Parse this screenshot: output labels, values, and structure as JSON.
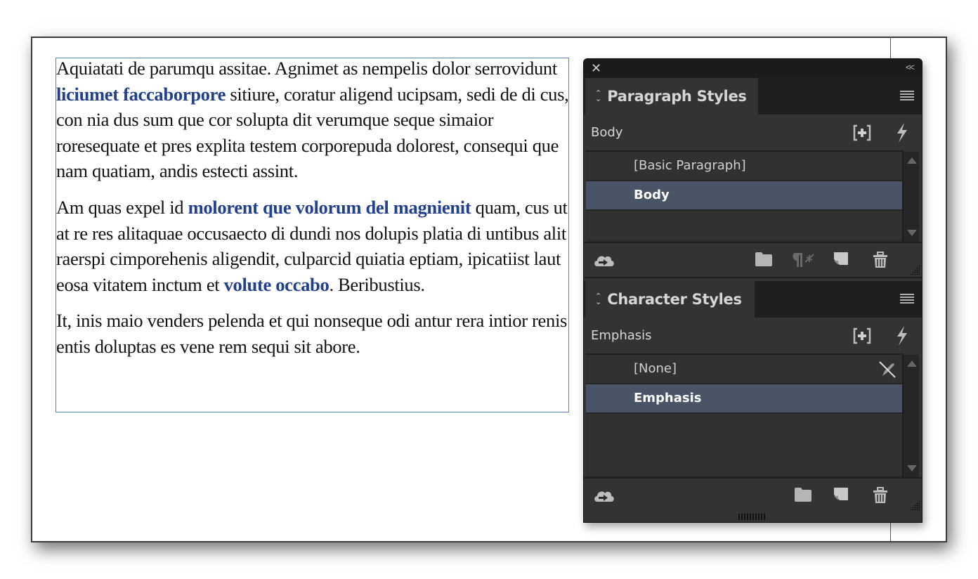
{
  "document": {
    "paragraphs": [
      {
        "runs": [
          {
            "text": "Aquiatati de parumqu assitae. Agnimet as nempelis dolor serrovidunt ",
            "style": "normal"
          },
          {
            "text": "liciumet faccaborpore",
            "style": "emphasis"
          },
          {
            "text": " sitiure, coratur aligend ucipsam, sedi de di cus, con nia dus sum que cor solupta dit verumque seque simaior roresequate et pres explita testem corporepuda dolorest, consequi que nam quatiam, andis estecti assint.",
            "style": "normal"
          }
        ]
      },
      {
        "runs": [
          {
            "text": "Am quas expel id ",
            "style": "normal"
          },
          {
            "text": "molorent que volorum del magnienit",
            "style": "emphasis"
          },
          {
            "text": " quam, cus ut at re res alitaquae occusaecto di dundi nos dolupis platia di untibus alit raerspi cimporehenis aligendit, culparcid quiatia eptiam, ipicatiist laut eosa vitatem inctum et ",
            "style": "normal"
          },
          {
            "text": "volute occabo",
            "style": "emphasis"
          },
          {
            "text": ". Beribustius.",
            "style": "normal"
          }
        ]
      },
      {
        "runs": [
          {
            "text": "It, inis maio venders pelenda et qui nonseque odi antur rera intior renis entis doluptas es vene rem sequi sit abore.",
            "style": "normal"
          }
        ]
      }
    ],
    "emphasis_color": "#23408e"
  },
  "panel": {
    "close_icon": "close-icon",
    "collapse_label": "<<",
    "paragraph_styles": {
      "tab_label": "Paragraph Styles",
      "current_style": "Body",
      "items": [
        {
          "label": "[Basic Paragraph]",
          "selected": false
        },
        {
          "label": "Body",
          "selected": true
        }
      ],
      "footer_icons": [
        "cloud-library-icon",
        "folder-icon",
        "clear-overrides-icon",
        "new-style-icon",
        "delete-icon"
      ]
    },
    "character_styles": {
      "tab_label": "Character Styles",
      "current_style": "Emphasis",
      "items": [
        {
          "label": "[None]",
          "selected": false,
          "icon": "no-edit-pencil-icon"
        },
        {
          "label": "Emphasis",
          "selected": true
        }
      ],
      "footer_icons": [
        "cloud-library-icon",
        "folder-icon",
        "new-style-icon",
        "delete-icon"
      ]
    },
    "selection_color": "#495566"
  }
}
